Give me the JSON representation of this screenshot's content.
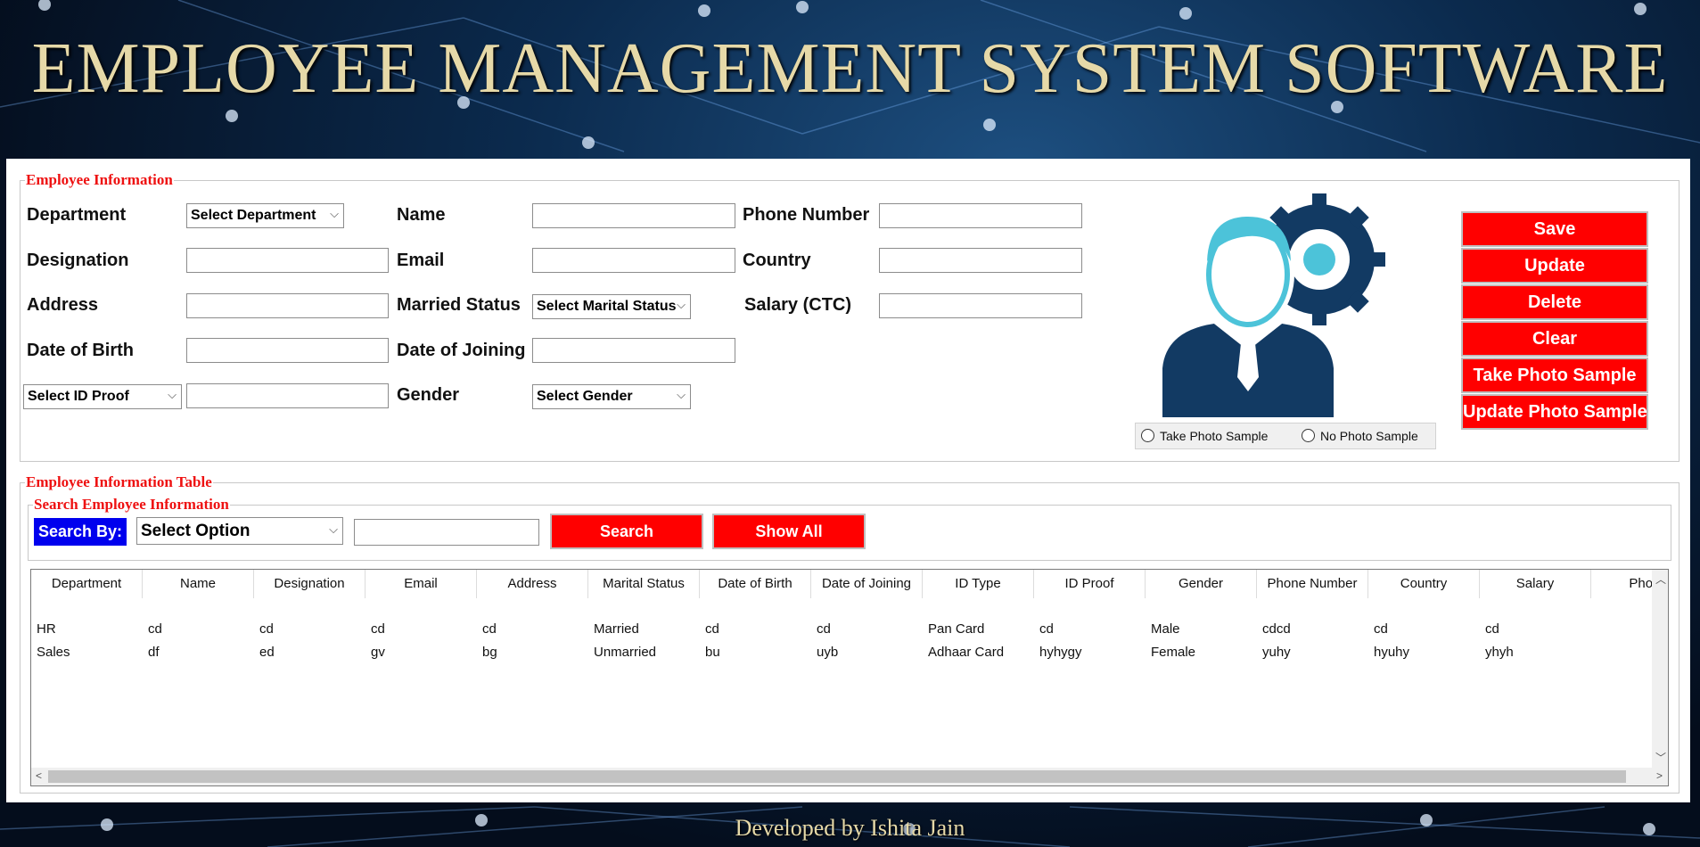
{
  "app": {
    "title": "EMPLOYEE MANAGEMENT SYSTEM SOFTWARE",
    "footer": "Developed by Ishita Jain"
  },
  "employee_info": {
    "legend": "Employee Information",
    "labels": {
      "department": "Department",
      "designation": "Designation",
      "address": "Address",
      "dob": "Date of Birth",
      "name": "Name",
      "email": "Email",
      "married_status": "Married Status",
      "doj": "Date of Joining",
      "gender": "Gender",
      "phone": "Phone Number",
      "country": "Country",
      "salary": "Salary (CTC)"
    },
    "combos": {
      "department": "Select Department",
      "marital": "Select Marital Status",
      "id_proof": "Select ID Proof",
      "gender": "Select Gender"
    },
    "fields": {
      "designation": "",
      "address": "",
      "dob": "",
      "id_proof": "",
      "name": "",
      "email": "",
      "doj": "",
      "phone": "",
      "country": "",
      "salary": ""
    },
    "radio_take": "Take Photo Sample",
    "radio_no": "No Photo Sample",
    "buttons": {
      "save": "Save",
      "update": "Update",
      "delete": "Delete",
      "clear": "Clear",
      "take_photo": "Take Photo Sample",
      "update_photo": "Update Photo Sample"
    }
  },
  "table_section": {
    "legend": "Employee Information Table",
    "search_legend": "Search Employee Information",
    "search_by": "Search By:",
    "search_option": "Select Option",
    "search_value": "",
    "search_button": "Search",
    "show_all_button": "Show All",
    "columns": [
      "Department",
      "Name",
      "Designation",
      "Email",
      "Address",
      "Marital Status",
      "Date of Birth",
      "Date of Joining",
      "ID Type",
      "ID Proof",
      "Gender",
      "Phone Number",
      "Country",
      "Salary",
      "Photo"
    ],
    "rows": [
      [
        "HR",
        "cd",
        "cd",
        "cd",
        "cd",
        "Married",
        "cd",
        "cd",
        "Pan Card",
        "cd",
        "Male",
        "cdcd",
        "cd",
        "cd",
        ""
      ],
      [
        "Sales",
        "df",
        "ed",
        "gv",
        "bg",
        "Unmarried",
        "bu",
        "uyb",
        "Adhaar Card",
        "hyhygy",
        "Female",
        "yuhy",
        "hyuhy",
        "yhyh",
        ""
      ]
    ]
  },
  "colors": {
    "accent_red": "#ff0000",
    "legend_red": "#ee1111",
    "search_by_blue": "#0000ee",
    "title_gold": "#e6d9a8"
  }
}
